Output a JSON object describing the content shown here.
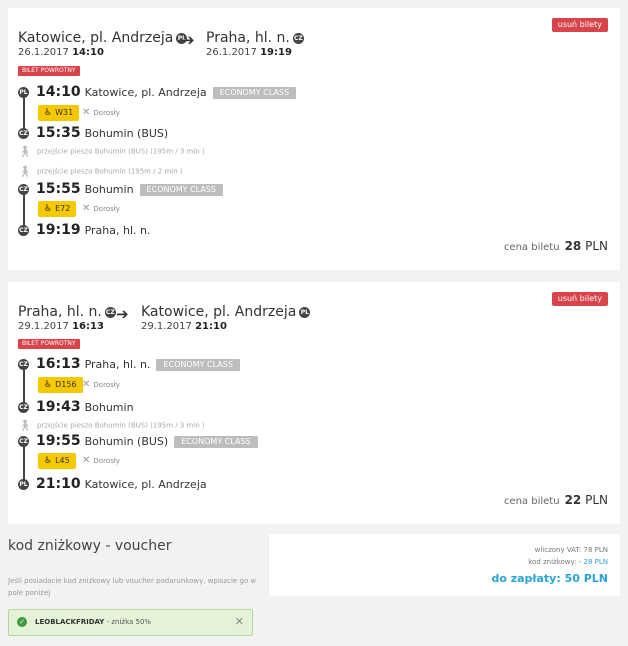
{
  "delete_label": "usuń bilety",
  "return_badge": "BILET POWROTNY",
  "price_label": "cena biletu",
  "currency": "PLN",
  "pax_label": "Dorosły",
  "class_label": "ECONOMY CLASS",
  "colors": {
    "badge_red": "#d9444b",
    "seat_yellow": "#f5c800",
    "link_blue": "#29a3d8",
    "ok_green": "#e4f2d8"
  },
  "trip1": {
    "from": "Katowice, pl. Andrzeja",
    "from_cc": "PL",
    "to": "Praha, hl. n.",
    "to_cc": "CZ",
    "dep_date": "26.1.2017",
    "dep_time": "14:10",
    "arr_date": "26.1.2017",
    "arr_time": "19:19",
    "stops": [
      {
        "cc": "PL",
        "time": "14:10",
        "name": "Katowice, pl. Andrzeja"
      },
      {
        "cc": "CZ",
        "time": "15:35",
        "name": "Bohumin (BUS)"
      },
      {
        "cc": "CZ",
        "time": "15:55",
        "name": "Bohumin"
      },
      {
        "cc": "CZ",
        "time": "19:19",
        "name": "Praha, hl. n."
      }
    ],
    "seats": [
      "W31",
      "E72"
    ],
    "walks": [
      "przejście pieszo Bohumin (BUS) (195m / 3 min )",
      "przejście pieszo Bohumin (195m / 2 min )"
    ],
    "price": "28"
  },
  "trip2": {
    "from": "Praha, hl. n.",
    "from_cc": "CZ",
    "to": "Katowice, pl. Andrzeja",
    "to_cc": "PL",
    "dep_date": "29.1.2017",
    "dep_time": "16:13",
    "arr_date": "29.1.2017",
    "arr_time": "21:10",
    "stops": [
      {
        "cc": "CZ",
        "time": "16:13",
        "name": "Praha, hl. n."
      },
      {
        "cc": "CZ",
        "time": "19:43",
        "name": "Bohumin"
      },
      {
        "cc": "CZ",
        "time": "19:55",
        "name": "Bohumin (BUS)"
      },
      {
        "cc": "PL",
        "time": "21:10",
        "name": "Katowice, pl. Andrzeja"
      }
    ],
    "seats": [
      "D156",
      "L45"
    ],
    "walks": [
      "przejście pieszo Bohumin (BUS) (195m / 3 min )"
    ],
    "price": "22"
  },
  "voucher": {
    "title": "kod zniżkowy - voucher",
    "description": "Jeśli posiadacie kod zniżkowy lub voucher podarunkowy, wpiszcie go w pole poniżej",
    "code": "LEOBLACKFRIDAY",
    "discount": " - zniżka 50%"
  },
  "summary": {
    "vat": "wliczony VAT: 78 PLN",
    "code_label": "kod zniżkowy: ",
    "code_value": "- 28 PLN",
    "total": "do zapłaty: 50 PLN"
  }
}
